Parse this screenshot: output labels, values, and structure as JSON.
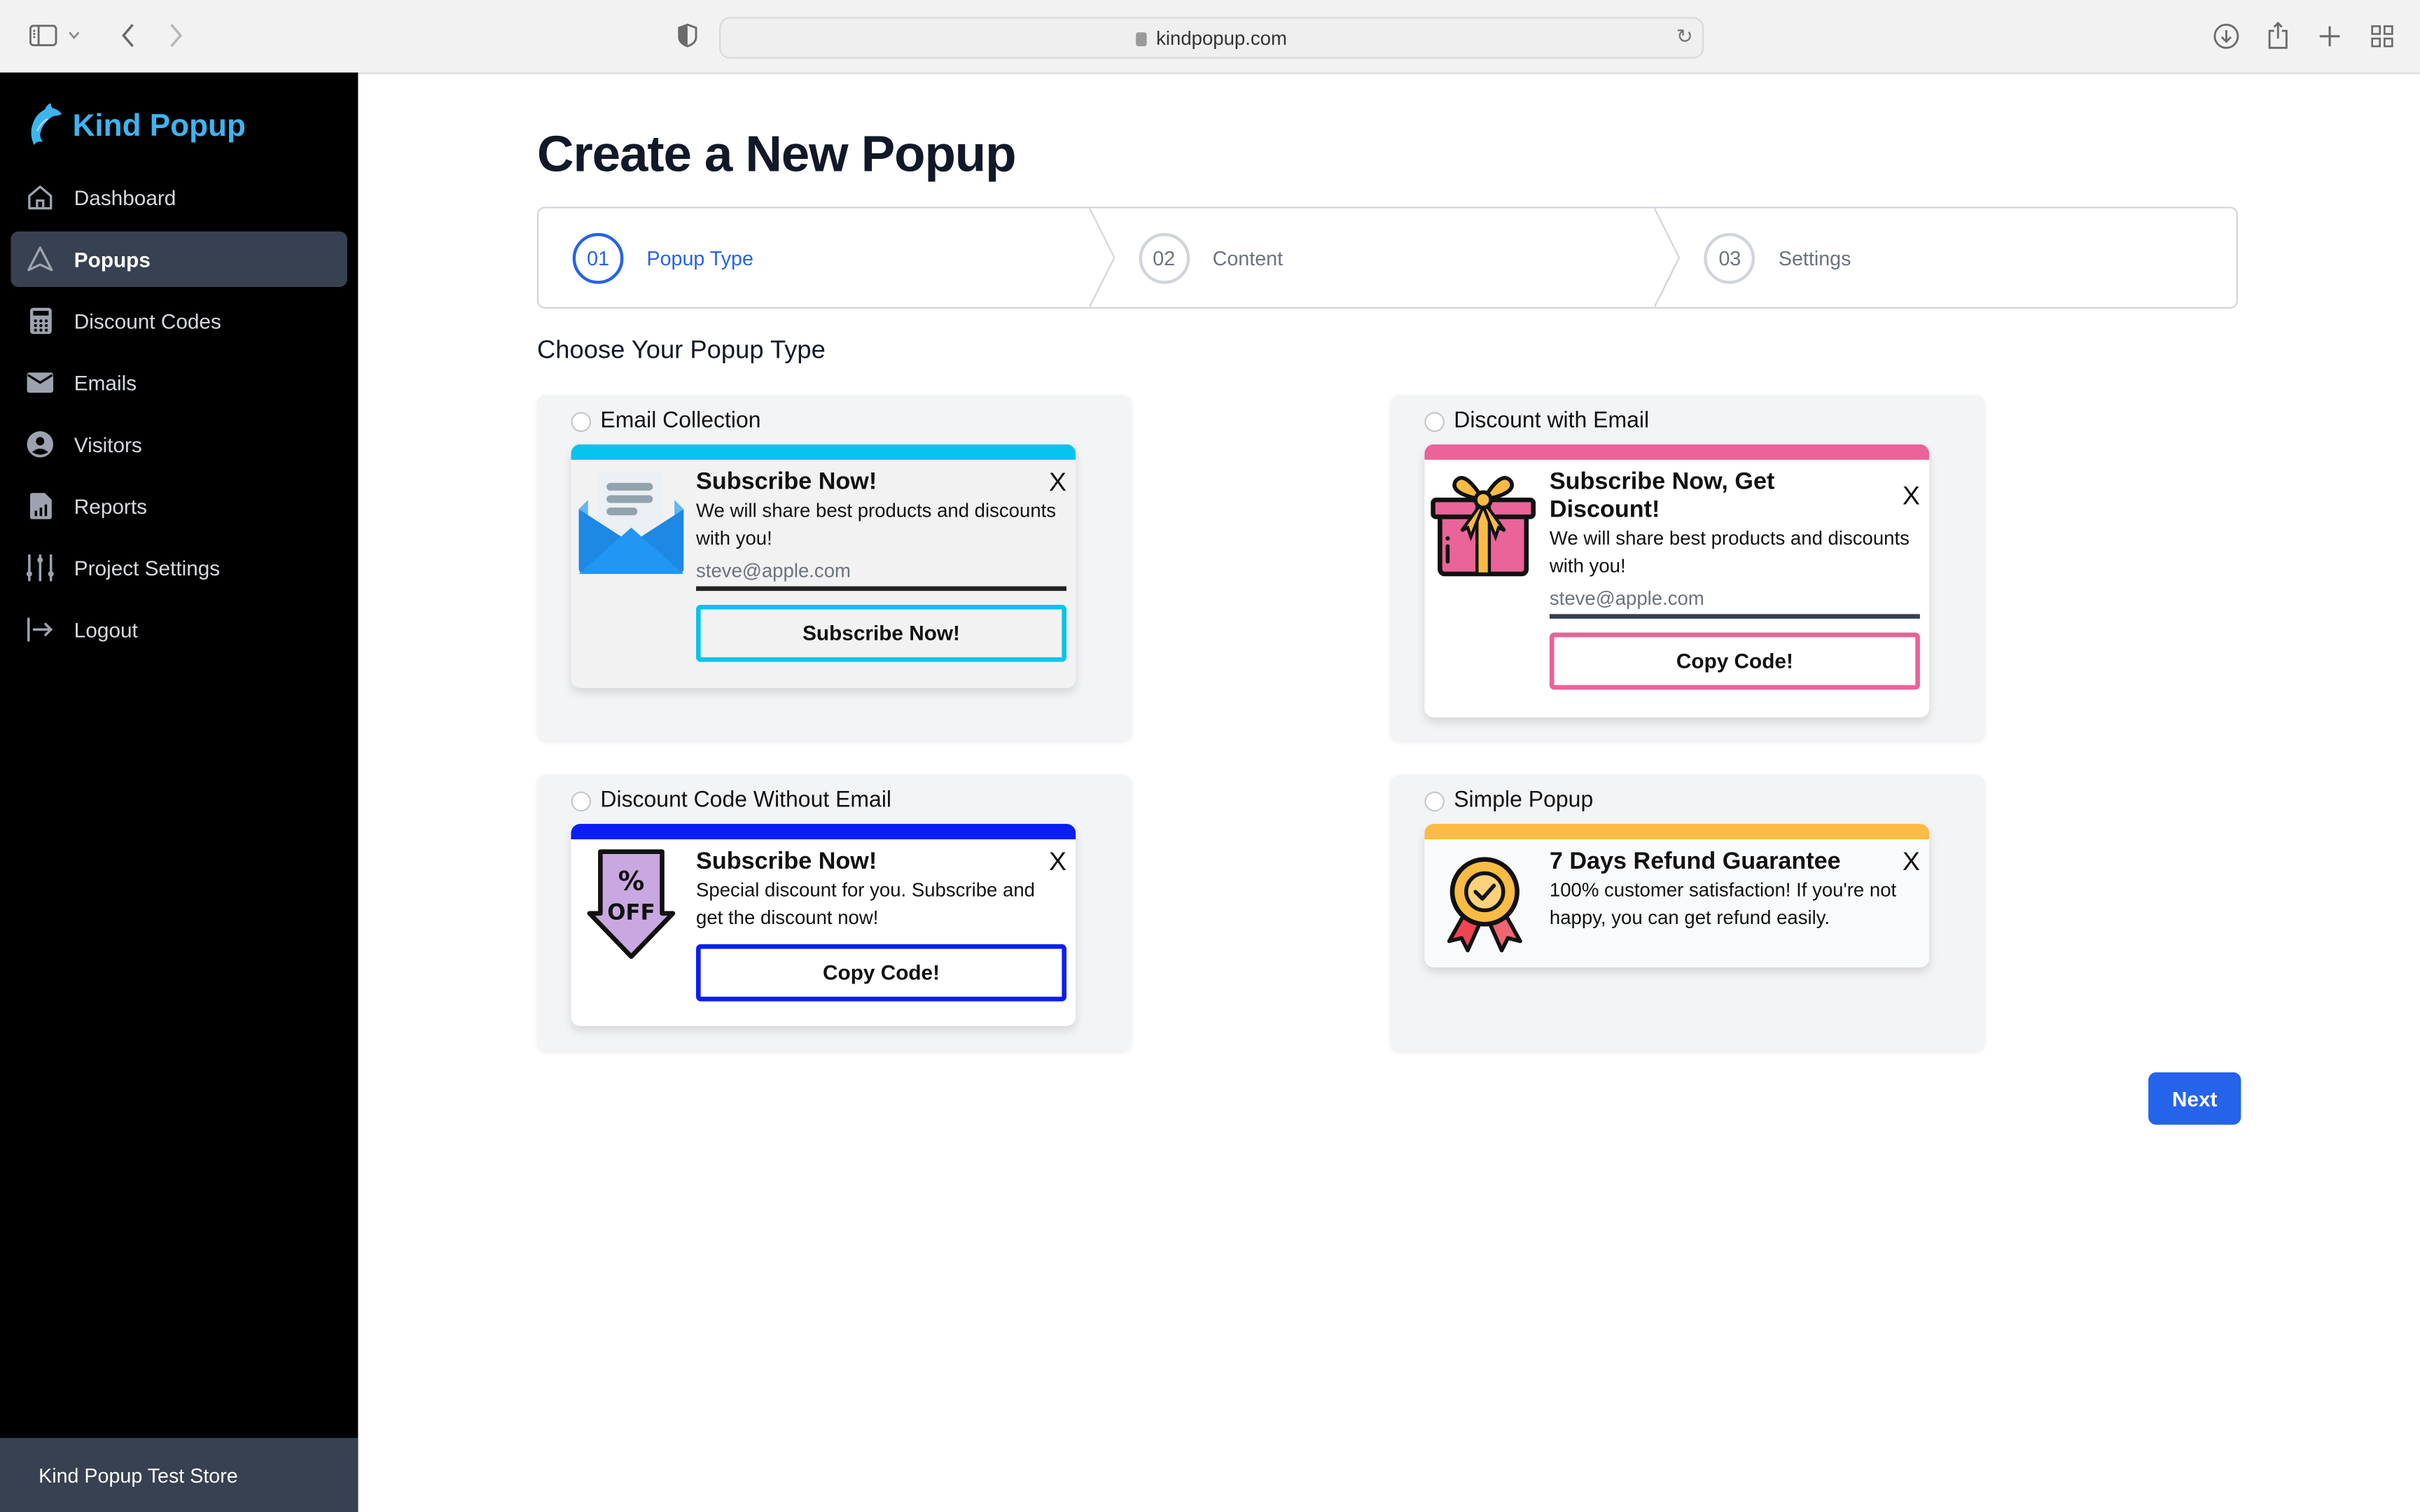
{
  "browser": {
    "url": "kindpopup.com",
    "icons": [
      "sidebar-toggle-icon",
      "chevron-down-icon",
      "back-icon",
      "forward-icon",
      "privacy-shield-icon",
      "lock-icon",
      "reload-icon",
      "download-icon",
      "share-icon",
      "new-tab-icon",
      "tab-overview-icon"
    ]
  },
  "sidebar": {
    "brand": "Kind Popup",
    "items": [
      {
        "label": "Dashboard",
        "icon": "home-icon",
        "active": false
      },
      {
        "label": "Popups",
        "icon": "navigation-arrow-icon",
        "active": true
      },
      {
        "label": "Discount Codes",
        "icon": "calculator-icon",
        "active": false
      },
      {
        "label": "Emails",
        "icon": "envelope-icon",
        "active": false
      },
      {
        "label": "Visitors",
        "icon": "user-circle-icon",
        "active": false
      },
      {
        "label": "Reports",
        "icon": "report-chart-icon",
        "active": false
      },
      {
        "label": "Project Settings",
        "icon": "sliders-icon",
        "active": false
      },
      {
        "label": "Logout",
        "icon": "logout-icon",
        "active": false
      }
    ],
    "store": "Kind Popup Test Store"
  },
  "main": {
    "title": "Create a New Popup",
    "steps": [
      {
        "num": "01",
        "label": "Popup Type",
        "active": true
      },
      {
        "num": "02",
        "label": "Content",
        "active": false
      },
      {
        "num": "03",
        "label": "Settings",
        "active": false
      }
    ],
    "subtitle": "Choose Your Popup Type",
    "options": [
      {
        "label": "Email Collection",
        "selected": false,
        "accent": "#06c4ec",
        "preview": {
          "icon": "open-envelope-icon",
          "heading": "Subscribe Now!",
          "text": "We will share best products and discounts with you!",
          "email_placeholder": "steve@apple.com",
          "button": "Subscribe Now!",
          "close": "X"
        }
      },
      {
        "label": "Discount with Email",
        "selected": false,
        "accent": "#ea6399",
        "preview": {
          "icon": "gift-box-icon",
          "heading": "Subscribe Now, Get Discount!",
          "text": "We will share best products and discounts with you!",
          "email_placeholder": "steve@apple.com",
          "button": "Copy Code!",
          "close": "X"
        }
      },
      {
        "label": "Discount Code Without Email",
        "selected": false,
        "accent": "#0a1ef5",
        "preview": {
          "icon": "percent-off-arrow-icon",
          "icon_text": {
            "percent": "%",
            "off": "OFF"
          },
          "heading": "Subscribe Now!",
          "text": "Special discount for you. Subscribe and get the discount now!",
          "button": "Copy Code!",
          "close": "X"
        }
      },
      {
        "label": "Simple Popup",
        "selected": false,
        "accent": "#fbbb44",
        "preview": {
          "icon": "award-badge-icon",
          "heading": "7 Days Refund Guarantee",
          "text": "100% customer satisfaction! If you're not happy, you can get refund easily.",
          "close": "X"
        }
      }
    ],
    "next_button": "Next"
  }
}
